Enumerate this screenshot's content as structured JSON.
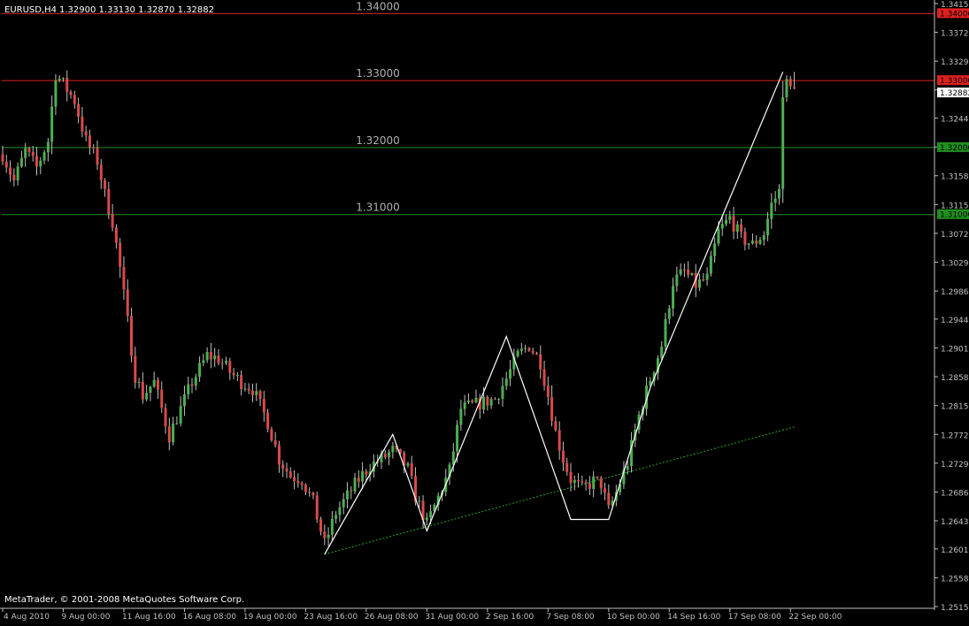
{
  "header": {
    "symbol": "EURUSD,H4",
    "ohlc": "1.32900 1.33130 1.32870 1.32882"
  },
  "copyright": "MetaTrader, © 2001-2008 MetaQuotes Software Corp.",
  "colors": {
    "background": "#000000",
    "axis": "#c0c0c0",
    "bull_candle": "#4caf50",
    "bear_candle": "#d94a4a",
    "wick": "#bfbfbf",
    "resistance_line": "#e02020",
    "support_line": "#1f8f1f",
    "zigzag": "#ffffff",
    "trendline": "#22aa22",
    "price_label_text": "#b0b0b0",
    "current_price_tag": "#ffffff"
  },
  "chart_data": {
    "type": "candlestick",
    "symbol": "EURUSD",
    "timeframe": "H4",
    "ylim": [
      1.2515,
      1.3415
    ],
    "y_ticks": [
      "1.34150",
      "1.33720",
      "1.33290",
      "1.32860",
      "1.32440",
      "1.32010",
      "1.31580",
      "1.31150",
      "1.30720",
      "1.30290",
      "1.29860",
      "1.29440",
      "1.29010",
      "1.28580",
      "1.28150",
      "1.27720",
      "1.27290",
      "1.26860",
      "1.26430",
      "1.26010",
      "1.25580",
      "1.25150"
    ],
    "x_ticks": [
      "4 Aug 2010",
      "9 Aug 00:00",
      "11 Aug 16:00",
      "16 Aug 08:00",
      "19 Aug 00:00",
      "23 Aug 16:00",
      "26 Aug 08:00",
      "31 Aug 00:00",
      "2 Sep 16:00",
      "7 Sep 08:00",
      "10 Sep 00:00",
      "14 Sep 16:00",
      "17 Sep 08:00",
      "22 Sep 00:00"
    ],
    "x_tick_positions": [
      0,
      16,
      32,
      48,
      64,
      80,
      96,
      112,
      128,
      144,
      160,
      176,
      192,
      208
    ],
    "bar_count": 210,
    "last": {
      "open": 1.329,
      "high": 1.3313,
      "low": 1.3287,
      "close": 1.32882
    },
    "price_path": [
      [
        0,
        1.319
      ],
      [
        3,
        1.315
      ],
      [
        6,
        1.3195
      ],
      [
        9,
        1.317
      ],
      [
        12,
        1.321
      ],
      [
        14,
        1.331
      ],
      [
        16,
        1.3295
      ],
      [
        19,
        1.327
      ],
      [
        22,
        1.321
      ],
      [
        25,
        1.318
      ],
      [
        27,
        1.313
      ],
      [
        29,
        1.309
      ],
      [
        31,
        1.302
      ],
      [
        33,
        1.294
      ],
      [
        35,
        1.286
      ],
      [
        37,
        1.283
      ],
      [
        40,
        1.285
      ],
      [
        44,
        1.277
      ],
      [
        47,
        1.281
      ],
      [
        50,
        1.285
      ],
      [
        54,
        1.289
      ],
      [
        57,
        1.2885
      ],
      [
        60,
        1.2865
      ],
      [
        63,
        1.285
      ],
      [
        66,
        1.284
      ],
      [
        70,
        1.279
      ],
      [
        73,
        1.2735
      ],
      [
        76,
        1.271
      ],
      [
        79,
        1.2705
      ],
      [
        82,
        1.267
      ],
      [
        85,
        1.2608
      ],
      [
        88,
        1.2655
      ],
      [
        91,
        1.268
      ],
      [
        94,
        1.2705
      ],
      [
        97,
        1.2725
      ],
      [
        100,
        1.2735
      ],
      [
        103,
        1.2748
      ],
      [
        105,
        1.2735
      ],
      [
        107,
        1.272
      ],
      [
        109,
        1.268
      ],
      [
        112,
        1.2638
      ],
      [
        115,
        1.2678
      ],
      [
        118,
        1.2718
      ],
      [
        121,
        1.281
      ],
      [
        124,
        1.2815
      ],
      [
        127,
        1.282
      ],
      [
        130,
        1.2825
      ],
      [
        133,
        1.2855
      ],
      [
        136,
        1.289
      ],
      [
        139,
        1.2905
      ],
      [
        142,
        1.288
      ],
      [
        144,
        1.283
      ],
      [
        146,
        1.2775
      ],
      [
        148,
        1.2735
      ],
      [
        150,
        1.2705
      ],
      [
        153,
        1.269
      ],
      [
        156,
        1.2702
      ],
      [
        158,
        1.2698
      ],
      [
        160,
        1.2658
      ],
      [
        162,
        1.2685
      ],
      [
        165,
        1.273
      ],
      [
        168,
        1.28
      ],
      [
        171,
        1.2855
      ],
      [
        174,
        1.2905
      ],
      [
        177,
        1.3
      ],
      [
        180,
        1.3015
      ],
      [
        183,
        1.2995
      ],
      [
        186,
        1.3005
      ],
      [
        189,
        1.3075
      ],
      [
        192,
        1.3095
      ],
      [
        195,
        1.3065
      ],
      [
        198,
        1.3055
      ],
      [
        201,
        1.3072
      ],
      [
        203,
        1.3115
      ],
      [
        205,
        1.3135
      ],
      [
        206,
        1.3285
      ],
      [
        207,
        1.3295
      ],
      [
        208,
        1.3288
      ]
    ],
    "horizontal_lines": [
      {
        "price": 1.34,
        "label": "1.34000",
        "tag": "1.34000",
        "style": "resistance"
      },
      {
        "price": 1.33,
        "label": "1.33000",
        "tag": "1.33000",
        "style": "resistance"
      },
      {
        "price": 1.32,
        "label": "1.32000",
        "tag": "1.32000",
        "style": "support"
      },
      {
        "price": 1.31,
        "label": "1.31000",
        "tag": "1.31000",
        "style": "support"
      }
    ],
    "current_price_tag": "1.32882",
    "zigzag": [
      [
        85,
        1.2593
      ],
      [
        103,
        1.2772
      ],
      [
        112,
        1.2628
      ],
      [
        133,
        1.2918
      ],
      [
        150,
        1.2645
      ],
      [
        160,
        1.2645
      ],
      [
        171,
        1.2842
      ],
      [
        206,
        1.3313
      ]
    ],
    "trendline": {
      "start": [
        85,
        1.2593
      ],
      "end": [
        209,
        1.2783
      ]
    }
  }
}
